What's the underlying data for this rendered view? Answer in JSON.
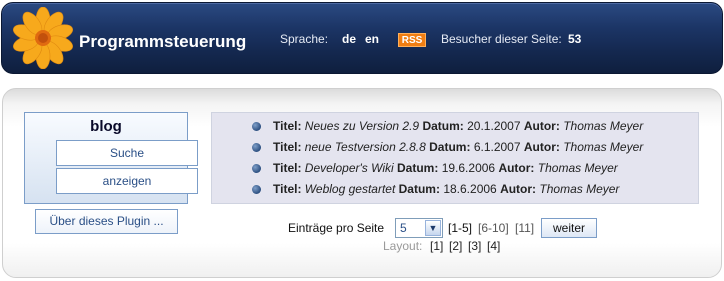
{
  "header": {
    "title": "Programmsteuerung",
    "language_label": "Sprache:",
    "languages": [
      "de",
      "en"
    ],
    "rss": "RSS",
    "visitors_label": "Besucher dieser Seite:",
    "visitors_count": "53"
  },
  "sidebar": {
    "title": "blog",
    "items": [
      {
        "label": "Suche"
      },
      {
        "label": "anzeigen"
      }
    ],
    "plugin_button": "Über dieses Plugin ..."
  },
  "entries": {
    "labels": {
      "title": "Titel:",
      "date": "Datum:",
      "author": "Autor:"
    },
    "items": [
      {
        "title": "Neues zu Version 2.9",
        "date": "20.1.2007",
        "author": "Thomas Meyer"
      },
      {
        "title": "neue Testversion 2.8.8",
        "date": "6.1.2007",
        "author": "Thomas Meyer"
      },
      {
        "title": "Developer's Wiki",
        "date": "19.6.2006",
        "author": "Thomas Meyer"
      },
      {
        "title": "Weblog gestartet",
        "date": "18.6.2006",
        "author": "Thomas Meyer"
      }
    ]
  },
  "pager": {
    "per_page_label": "Einträge pro Seite",
    "per_page_value": "5",
    "current_range": "[1-5]",
    "ranges": [
      "[6-10]",
      "[11]"
    ],
    "next_label": "weiter",
    "layout_label": "Layout:",
    "layouts": [
      "[1]",
      "[2]",
      "[3]",
      "[4]"
    ]
  },
  "colors": {
    "header_bg": "#1c3566",
    "rss_badge": "#f07e13",
    "link_blue": "#2a4f86"
  },
  "icons": {
    "logo": "flower-icon",
    "bullet": "bullet-icon",
    "dropdown": "chevron-down-icon"
  }
}
